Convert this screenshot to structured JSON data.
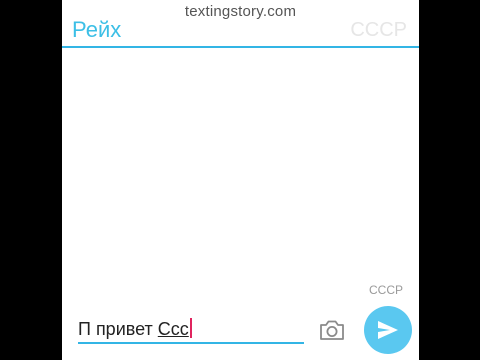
{
  "watermark": "textingstory.com",
  "header": {
    "contact_name": "Рейх",
    "right_label": "СССР"
  },
  "messages": {
    "sender_label": "СССР"
  },
  "composer": {
    "text_main": "П привет ",
    "text_underlined": "Ссс",
    "camera_icon": "camera-icon",
    "send_icon": "send-icon"
  },
  "colors": {
    "accent": "#33b5e5",
    "send_button": "#5ac8f0",
    "cursor": "#e0245e"
  }
}
